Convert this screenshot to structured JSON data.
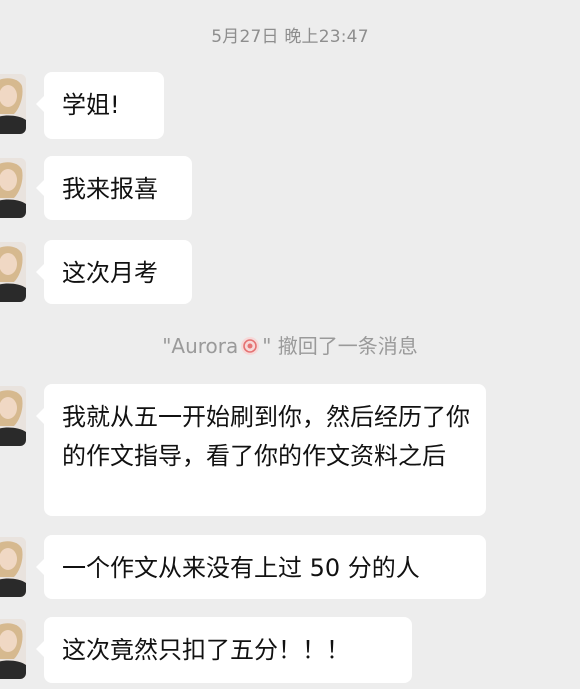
{
  "chat": {
    "timestamp": "5月27日 晚上23:47",
    "messages_part1": [
      {
        "text": "学姐!"
      },
      {
        "text": "我来报喜"
      },
      {
        "text": "这次月考"
      }
    ],
    "recall_notice": {
      "quote_open": "\"Aurora",
      "emoji": "swirl-emoji",
      "quote_close": "\"",
      "text": " 撤回了一条消息"
    },
    "messages_part2": [
      {
        "text": "我就从五一开始刷到你，然后经历了你的作文指导，看了你的作文资料之后"
      },
      {
        "text": "一个作文从来没有上过 50 分的人"
      },
      {
        "text": "这次竟然只扣了五分！！！"
      }
    ]
  }
}
